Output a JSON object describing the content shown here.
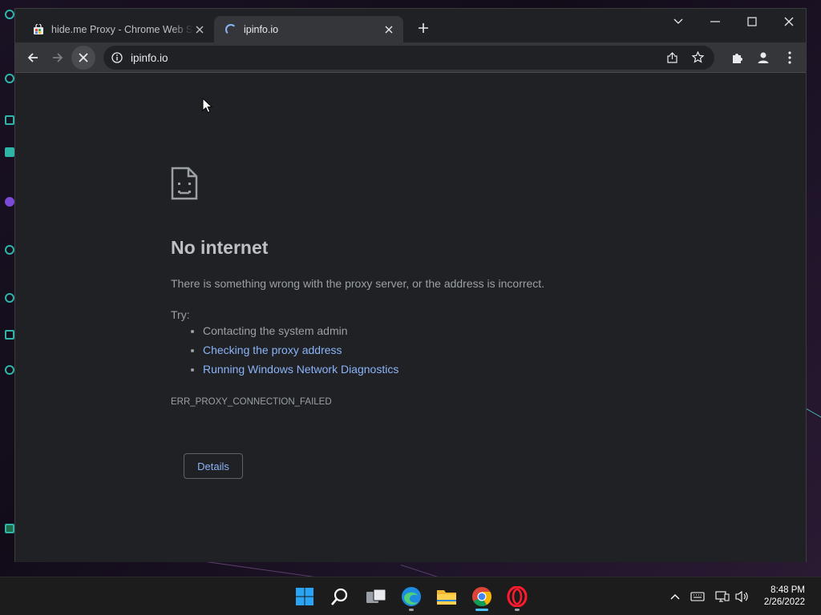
{
  "browser": {
    "tabs": [
      {
        "title": "hide.me Proxy - Chrome Web Store",
        "favicon": "chrome-web-store-icon",
        "active": false
      },
      {
        "title": "ipinfo.io",
        "favicon": "loading-spinner-icon",
        "active": true
      }
    ],
    "address": "ipinfo.io"
  },
  "error_page": {
    "title": "No internet",
    "message": "There is something wrong with the proxy server, or the address is incorrect.",
    "try_label": "Try:",
    "suggestions": [
      {
        "text": "Contacting the system admin",
        "link": false
      },
      {
        "text": "Checking the proxy address",
        "link": true
      },
      {
        "text": "Running Windows Network Diagnostics",
        "link": true
      }
    ],
    "error_code": "ERR_PROXY_CONNECTION_FAILED",
    "details_label": "Details"
  },
  "taskbar": {
    "apps": [
      "start-icon",
      "search-icon",
      "task-view-icon",
      "edge-icon",
      "file-explorer-icon",
      "chrome-icon",
      "opera-icon"
    ],
    "clock": {
      "time": "8:48 PM",
      "date": "2/26/2022"
    }
  },
  "colors": {
    "link": "#8ab4f8",
    "page_bg": "#202124",
    "toolbar_bg": "#35363a",
    "text_muted": "#9aa0a6"
  }
}
